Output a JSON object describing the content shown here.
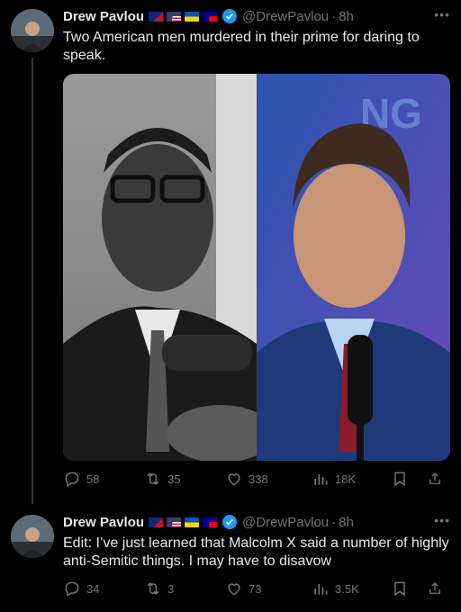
{
  "tweets": [
    {
      "author": "Drew Pavlou",
      "handle": "@DrewPavlou",
      "separator": "·",
      "time": "8h",
      "text": "Two American men murdered in their prime for daring to speak.",
      "stats": {
        "replies": "58",
        "reposts": "35",
        "likes": "338",
        "views": "18K"
      }
    },
    {
      "author": "Drew Pavlou",
      "handle": "@DrewPavlou",
      "separator": "·",
      "time": "8h",
      "text": "Edit: I’ve just learned that Malcolm X said a number of highly anti-Semitic things. I may have to disavow",
      "stats": {
        "replies": "34",
        "reposts": "3",
        "likes": "73",
        "views": "3.5K"
      }
    }
  ],
  "colors": {
    "background": "#000000",
    "text": "#e7e9ea",
    "muted": "#71767b",
    "verified": "#1d9bf0",
    "thread_line": "#333639"
  },
  "icons": [
    "reply-icon",
    "repost-icon",
    "like-icon",
    "views-icon",
    "bookmark-icon",
    "share-icon",
    "verified-icon",
    "more-icon"
  ]
}
